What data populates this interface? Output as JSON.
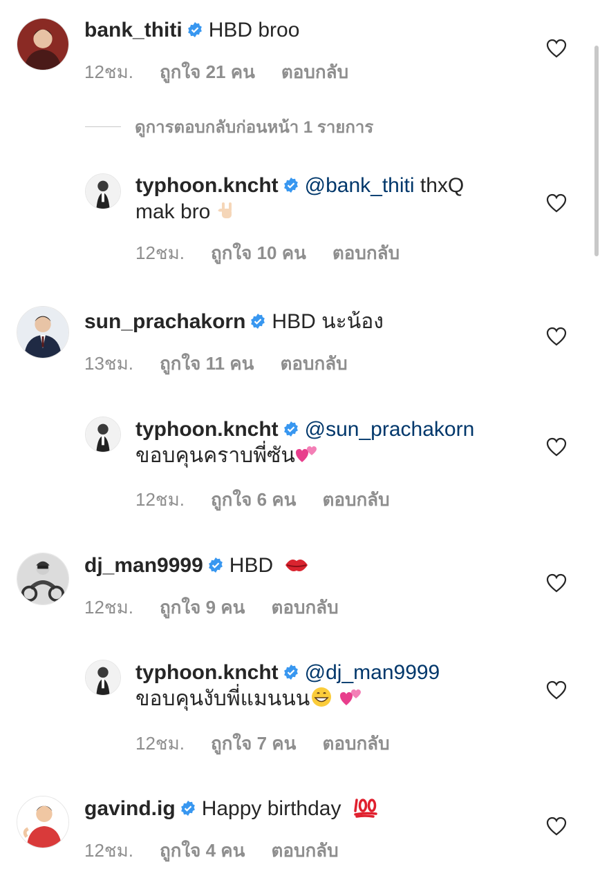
{
  "comments": [
    {
      "username": "bank_thiti",
      "text": "HBD broo",
      "time": "12ชม.",
      "likes": "ถูกใจ 21 คน",
      "reply": "ตอบกลับ",
      "view_previous": "ดูการตอบกลับก่อนหน้า 1 รายการ",
      "avatar_icon": "avatar-red-jacket",
      "replies": [
        {
          "username": "typhoon.kncht",
          "mention": "@bank_thiti",
          "text": " thxQ",
          "text2": "mak bro",
          "emoji": "rock-on-hand-emoji",
          "time": "12ชม.",
          "likes": "ถูกใจ 10 คน",
          "reply": "ตอบกลับ"
        }
      ]
    },
    {
      "username": "sun_prachakorn",
      "text": "HBD นะน้อง",
      "time": "13ชม.",
      "likes": "ถูกใจ 11 คน",
      "reply": "ตอบกลับ",
      "avatar_icon": "avatar-suit",
      "replies": [
        {
          "username": "typhoon.kncht",
          "mention": "@sun_prachakorn",
          "text2": "ขอบคุนคราบพี่ซัน",
          "emoji": "two-hearts-emoji",
          "time": "12ชม.",
          "likes": "ถูกใจ 6 คน",
          "reply": "ตอบกลับ"
        }
      ]
    },
    {
      "username": "dj_man9999",
      "text": "HBD",
      "emoji": "kiss-lips-emoji",
      "time": "12ชม.",
      "likes": "ถูกใจ 9 คน",
      "reply": "ตอบกลับ",
      "avatar_icon": "avatar-motorcycle",
      "replies": [
        {
          "username": "typhoon.kncht",
          "mention": "@dj_man9999",
          "text2": "ขอบคุนงับพี่แมนนน",
          "emoji": "grin-and-hearts-emoji",
          "time": "12ชม.",
          "likes": "ถูกใจ 7 คน",
          "reply": "ตอบกลับ"
        }
      ]
    },
    {
      "username": "gavind.ig",
      "text": "Happy birthday",
      "emoji": "hundred-points-emoji",
      "time": "12ชม.",
      "likes": "ถูกใจ 4 คน",
      "reply": "ตอบกลับ",
      "avatar_icon": "avatar-cartoon-red-shirt"
    }
  ],
  "colors": {
    "verified": "#3897f0",
    "mention": "#00376b",
    "meta": "#8e8e8e",
    "text": "#262626"
  }
}
